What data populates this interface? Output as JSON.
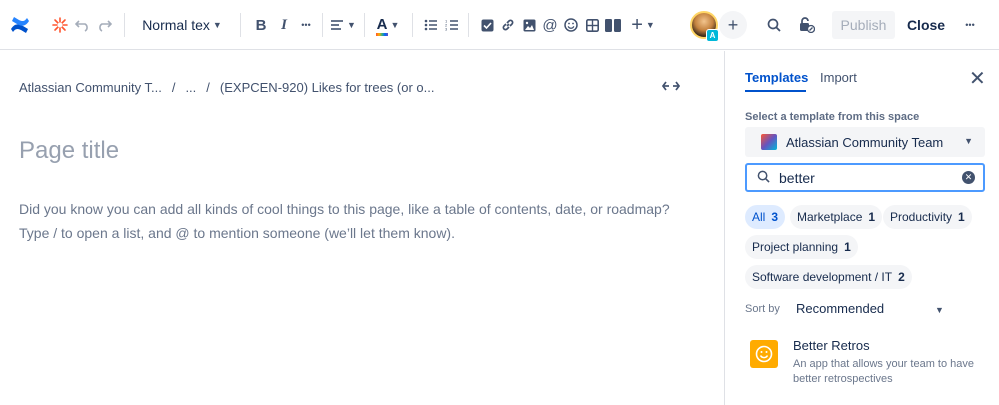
{
  "toolbar": {
    "text_style": "Normal tex",
    "bold": "B",
    "italic": "I",
    "more": "•••",
    "text_color": "A",
    "insert": "+",
    "avatar_badge": "A",
    "add_collab": "+",
    "publish_label": "Publish",
    "close_label": "Close",
    "overflow": "•••"
  },
  "editor": {
    "breadcrumb": [
      "Atlassian Community T...",
      "/",
      "...",
      "/",
      "(EXPCEN-920) Likes for trees (or o..."
    ],
    "width_toggle": "↔",
    "title_placeholder": "Page title",
    "body_line1": "Did you know you can add all kinds of cool things to this page, like a table of contents, date, or roadmap?",
    "body_line2": "Type / to open a list, and @ to mention someone (we’ll let them know)."
  },
  "panel": {
    "tabs": [
      {
        "label": "Templates",
        "active": true
      },
      {
        "label": "Import",
        "active": false
      }
    ],
    "close": "✕",
    "select_label": "Select a template from this space",
    "space_name": "Atlassian Community Team",
    "search_value": "better",
    "filters": [
      {
        "label": "All",
        "count": "3",
        "active": true
      },
      {
        "label": "Marketplace",
        "count": "1",
        "active": false
      },
      {
        "label": "Productivity",
        "count": "1",
        "active": false
      },
      {
        "label": "Project planning",
        "count": "1",
        "active": false
      },
      {
        "label": "Software development / IT",
        "count": "2",
        "active": false
      }
    ],
    "sort_label": "Sort by",
    "sort_value": "Recommended",
    "template": {
      "name": "Better Retros",
      "description": "An app that allows your team to have better retrospectives"
    }
  },
  "colors": {
    "brand": "#0052cc",
    "accent": "#4c9aff",
    "template_icon": "#ffab00"
  }
}
